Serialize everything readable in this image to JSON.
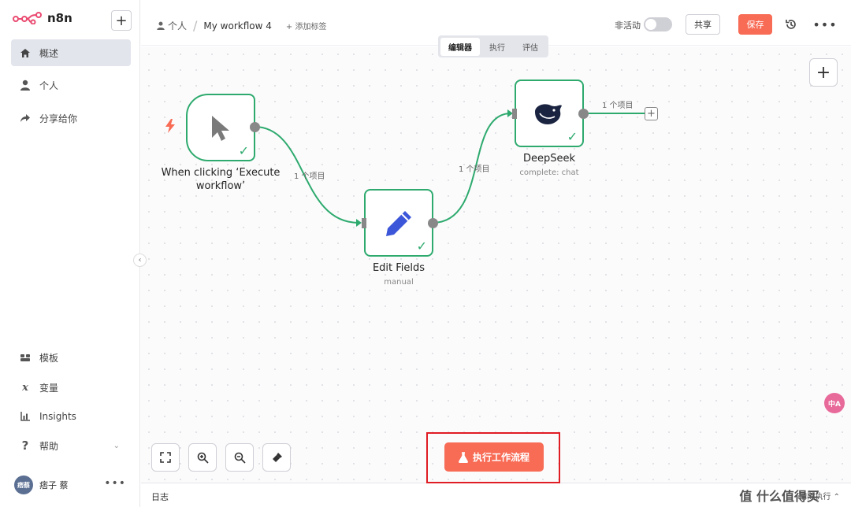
{
  "app": {
    "name": "n8n"
  },
  "sidebar": {
    "add_label": "+",
    "items": [
      {
        "label": "概述",
        "icon": "home-icon",
        "active": true
      },
      {
        "label": "个人",
        "icon": "user-icon"
      },
      {
        "label": "分享给你",
        "icon": "share-icon"
      },
      {
        "label": "模板",
        "icon": "template-icon"
      },
      {
        "label": "变量",
        "icon": "variable-icon"
      },
      {
        "label": "Insights",
        "icon": "insights-icon"
      },
      {
        "label": "帮助",
        "icon": "help-icon"
      }
    ],
    "user": {
      "avatar_text": "痞蔡",
      "name": "痞子 蔡"
    }
  },
  "header": {
    "breadcrumb_project": "个人",
    "breadcrumb_separator": "/",
    "workflow_name": "My workflow 4",
    "add_tag": "+ 添加标签",
    "active_label": "非活动",
    "share_label": "共享",
    "save_label": "保存"
  },
  "view_tabs": [
    "编辑器",
    "执行",
    "评估"
  ],
  "nodes": {
    "trigger": {
      "title": "When clicking ‘Execute workflow’",
      "subtitle": ""
    },
    "edit_fields": {
      "title": "Edit Fields",
      "subtitle": "manual"
    },
    "deepseek": {
      "title": "DeepSeek",
      "subtitle": "complete: chat"
    }
  },
  "edges": {
    "e1": "1 个项目",
    "e2": "1 个项目",
    "e3": "1 个项目"
  },
  "execute_button": "执行工作流程",
  "log": {
    "label": "日志",
    "right": "清除执行"
  },
  "colors": {
    "accent": "#f86b55",
    "success": "#2eaa6e",
    "highlight": "#e01c24"
  },
  "translate_badge": "中A",
  "watermark": "值 什么值得买"
}
